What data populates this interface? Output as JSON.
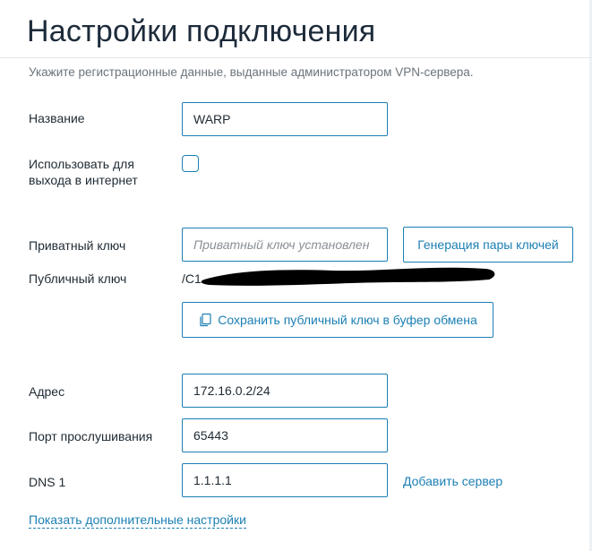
{
  "page": {
    "title": "Настройки подключения",
    "subtitle": "Укажите регистрационные данные, выданные администратором VPN-сервера."
  },
  "form": {
    "name": {
      "label": "Название",
      "value": "WARP"
    },
    "internet": {
      "label": "Использовать для выхода в интернет",
      "checked": false
    },
    "private_key": {
      "label": "Приватный ключ",
      "placeholder": "Приватный ключ установлен",
      "generate_button": "Генерация пары ключей"
    },
    "public_key": {
      "label": "Публичный ключ",
      "value": "/C1",
      "copy_button": "Сохранить публичный ключ в буфер обмена",
      "copy_icon": "copy-icon"
    },
    "address": {
      "label": "Адрес",
      "value": "172.16.0.2/24"
    },
    "listen_port": {
      "label": "Порт прослушивания",
      "value": "65443"
    },
    "dns1": {
      "label": "DNS 1",
      "value": "1.1.1.1",
      "add_server_link": "Добавить сервер"
    },
    "advanced_link": "Показать дополнительные настройки"
  },
  "colors": {
    "accent": "#1b7fb4",
    "title": "#1d2b3a",
    "muted": "#6b737b"
  }
}
